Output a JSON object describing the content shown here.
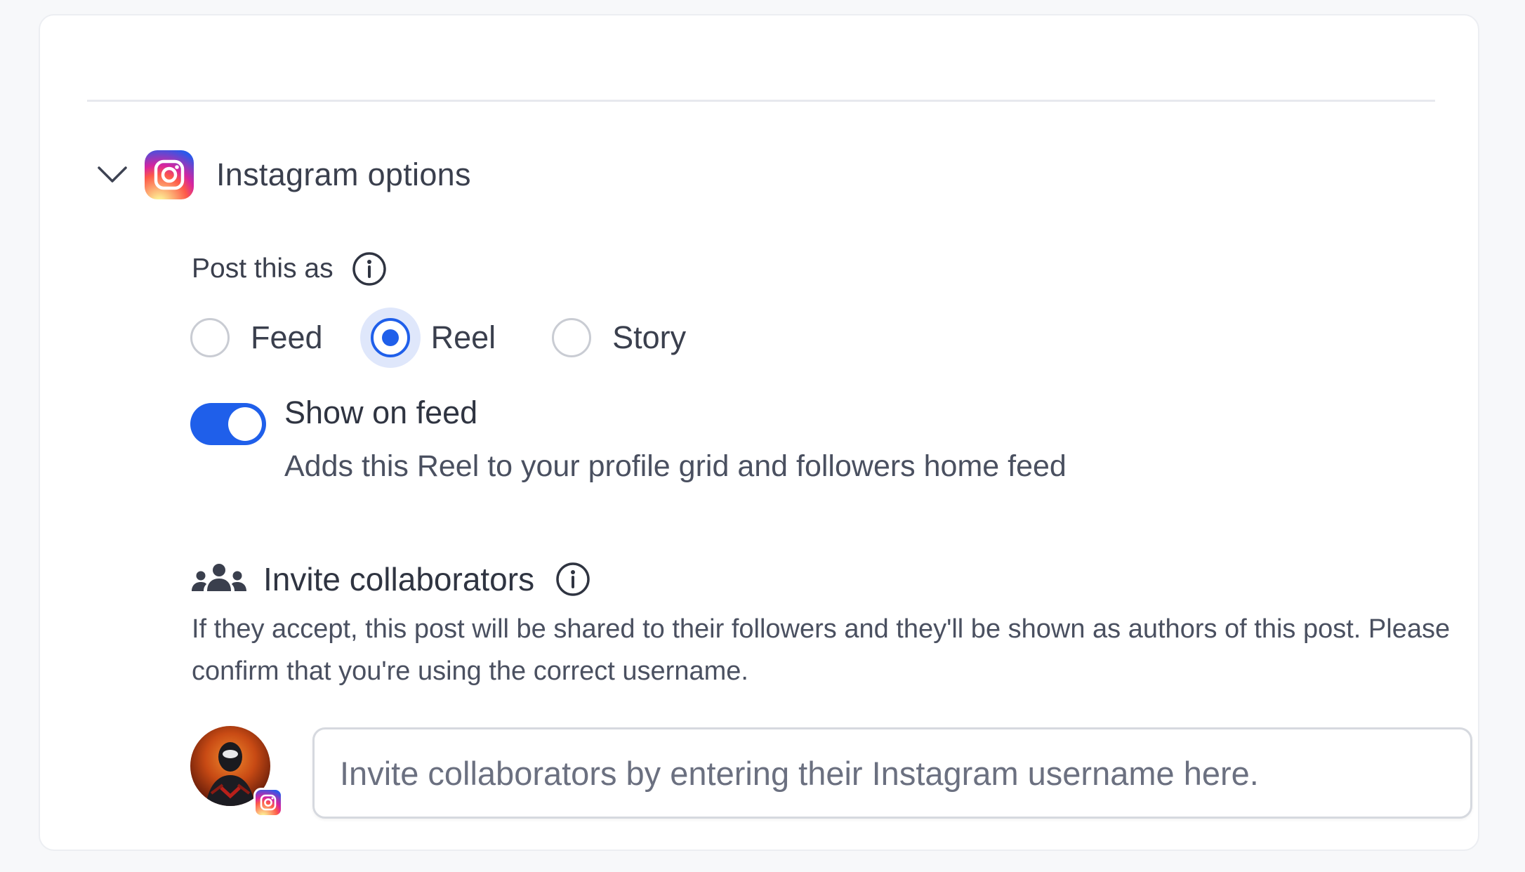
{
  "section": {
    "title": "Instagram options",
    "icon": "instagram-icon",
    "expanded": true
  },
  "post_as": {
    "label": "Post this as",
    "options": [
      {
        "label": "Feed",
        "selected": false
      },
      {
        "label": "Reel",
        "selected": true
      },
      {
        "label": "Story",
        "selected": false
      }
    ]
  },
  "show_on_feed": {
    "title": "Show on feed",
    "description": "Adds this Reel to your profile grid and followers home feed",
    "enabled": true
  },
  "collaborators": {
    "title": "Invite collaborators",
    "description": "If they accept, this post will be shared to their followers and they'll be shown as authors of this post. Please confirm that you're using the correct username.",
    "input_placeholder": "Invite collaborators by entering their Instagram username here.",
    "input_value": ""
  },
  "colors": {
    "accent": "#1f5fea",
    "text": "#3a3f4d",
    "border": "#d6d9df"
  }
}
